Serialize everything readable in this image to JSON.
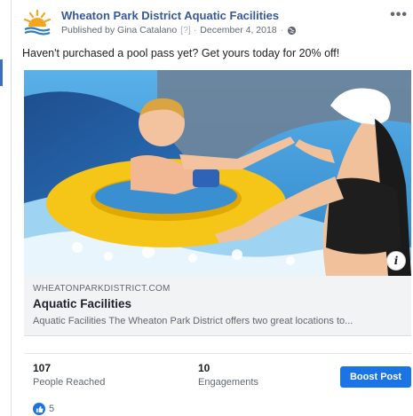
{
  "post": {
    "page_name": "Wheaton Park District Aquatic Facilities",
    "published_by": "Published by Gina Catalano",
    "date": "December 4, 2018",
    "message": "Haven't purchased a pool pass yet? Get yours today for 20% off!"
  },
  "link": {
    "domain": "WHEATONPARKDISTRICT.COM",
    "title": "Aquatic Facilities",
    "description": "Aquatic Facilities The Wheaton Park District offers two great locations to..."
  },
  "stats": {
    "reached_count": "107",
    "reached_label": "People Reached",
    "engagements_count": "10",
    "engagements_label": "Engagements"
  },
  "actions": {
    "boost_label": "Boost Post",
    "more_label": "•••"
  },
  "reactions": {
    "count": "5"
  },
  "icons": {
    "logo": "sun-logo-icon",
    "privacy": "globe-icon",
    "info": "info-icon",
    "reaction": "like-icon"
  },
  "colors": {
    "link_blue": "#385898",
    "boost_blue": "#1b74e4",
    "preview_bg": "#f2f3f5"
  }
}
